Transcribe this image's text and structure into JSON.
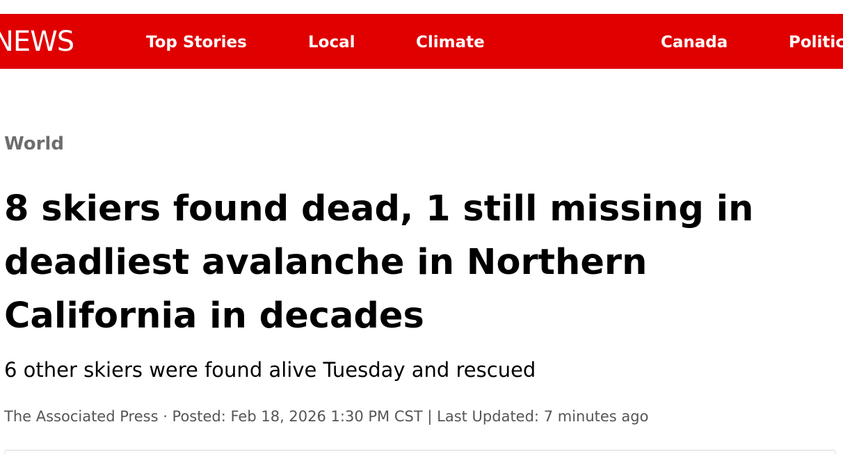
{
  "header": {
    "logo_text": "NEWS",
    "nav_items": [
      {
        "label": "Top Stories"
      },
      {
        "label": "Local"
      },
      {
        "label": "Climate"
      },
      {
        "label": ""
      },
      {
        "label": "Canada"
      },
      {
        "label": "Politic"
      }
    ]
  },
  "article": {
    "section": "World",
    "headline": "8 skiers found dead, 1 still missing in deadliest avalanche in Northern California in decades",
    "deck": "6 other skiers were found alive Tuesday and rescued",
    "byline": {
      "author": "The Associated Press",
      "separator": " · ",
      "posted_label": "Posted:",
      "posted_value": "Feb 18, 2026 1:30 PM CST",
      "divider": "|",
      "updated_label": "Last Updated:",
      "updated_value": "7 minutes ago"
    }
  },
  "colors": {
    "brand_red": "#e00000",
    "section_gray": "#6d6d6d",
    "meta_gray": "#555555"
  }
}
